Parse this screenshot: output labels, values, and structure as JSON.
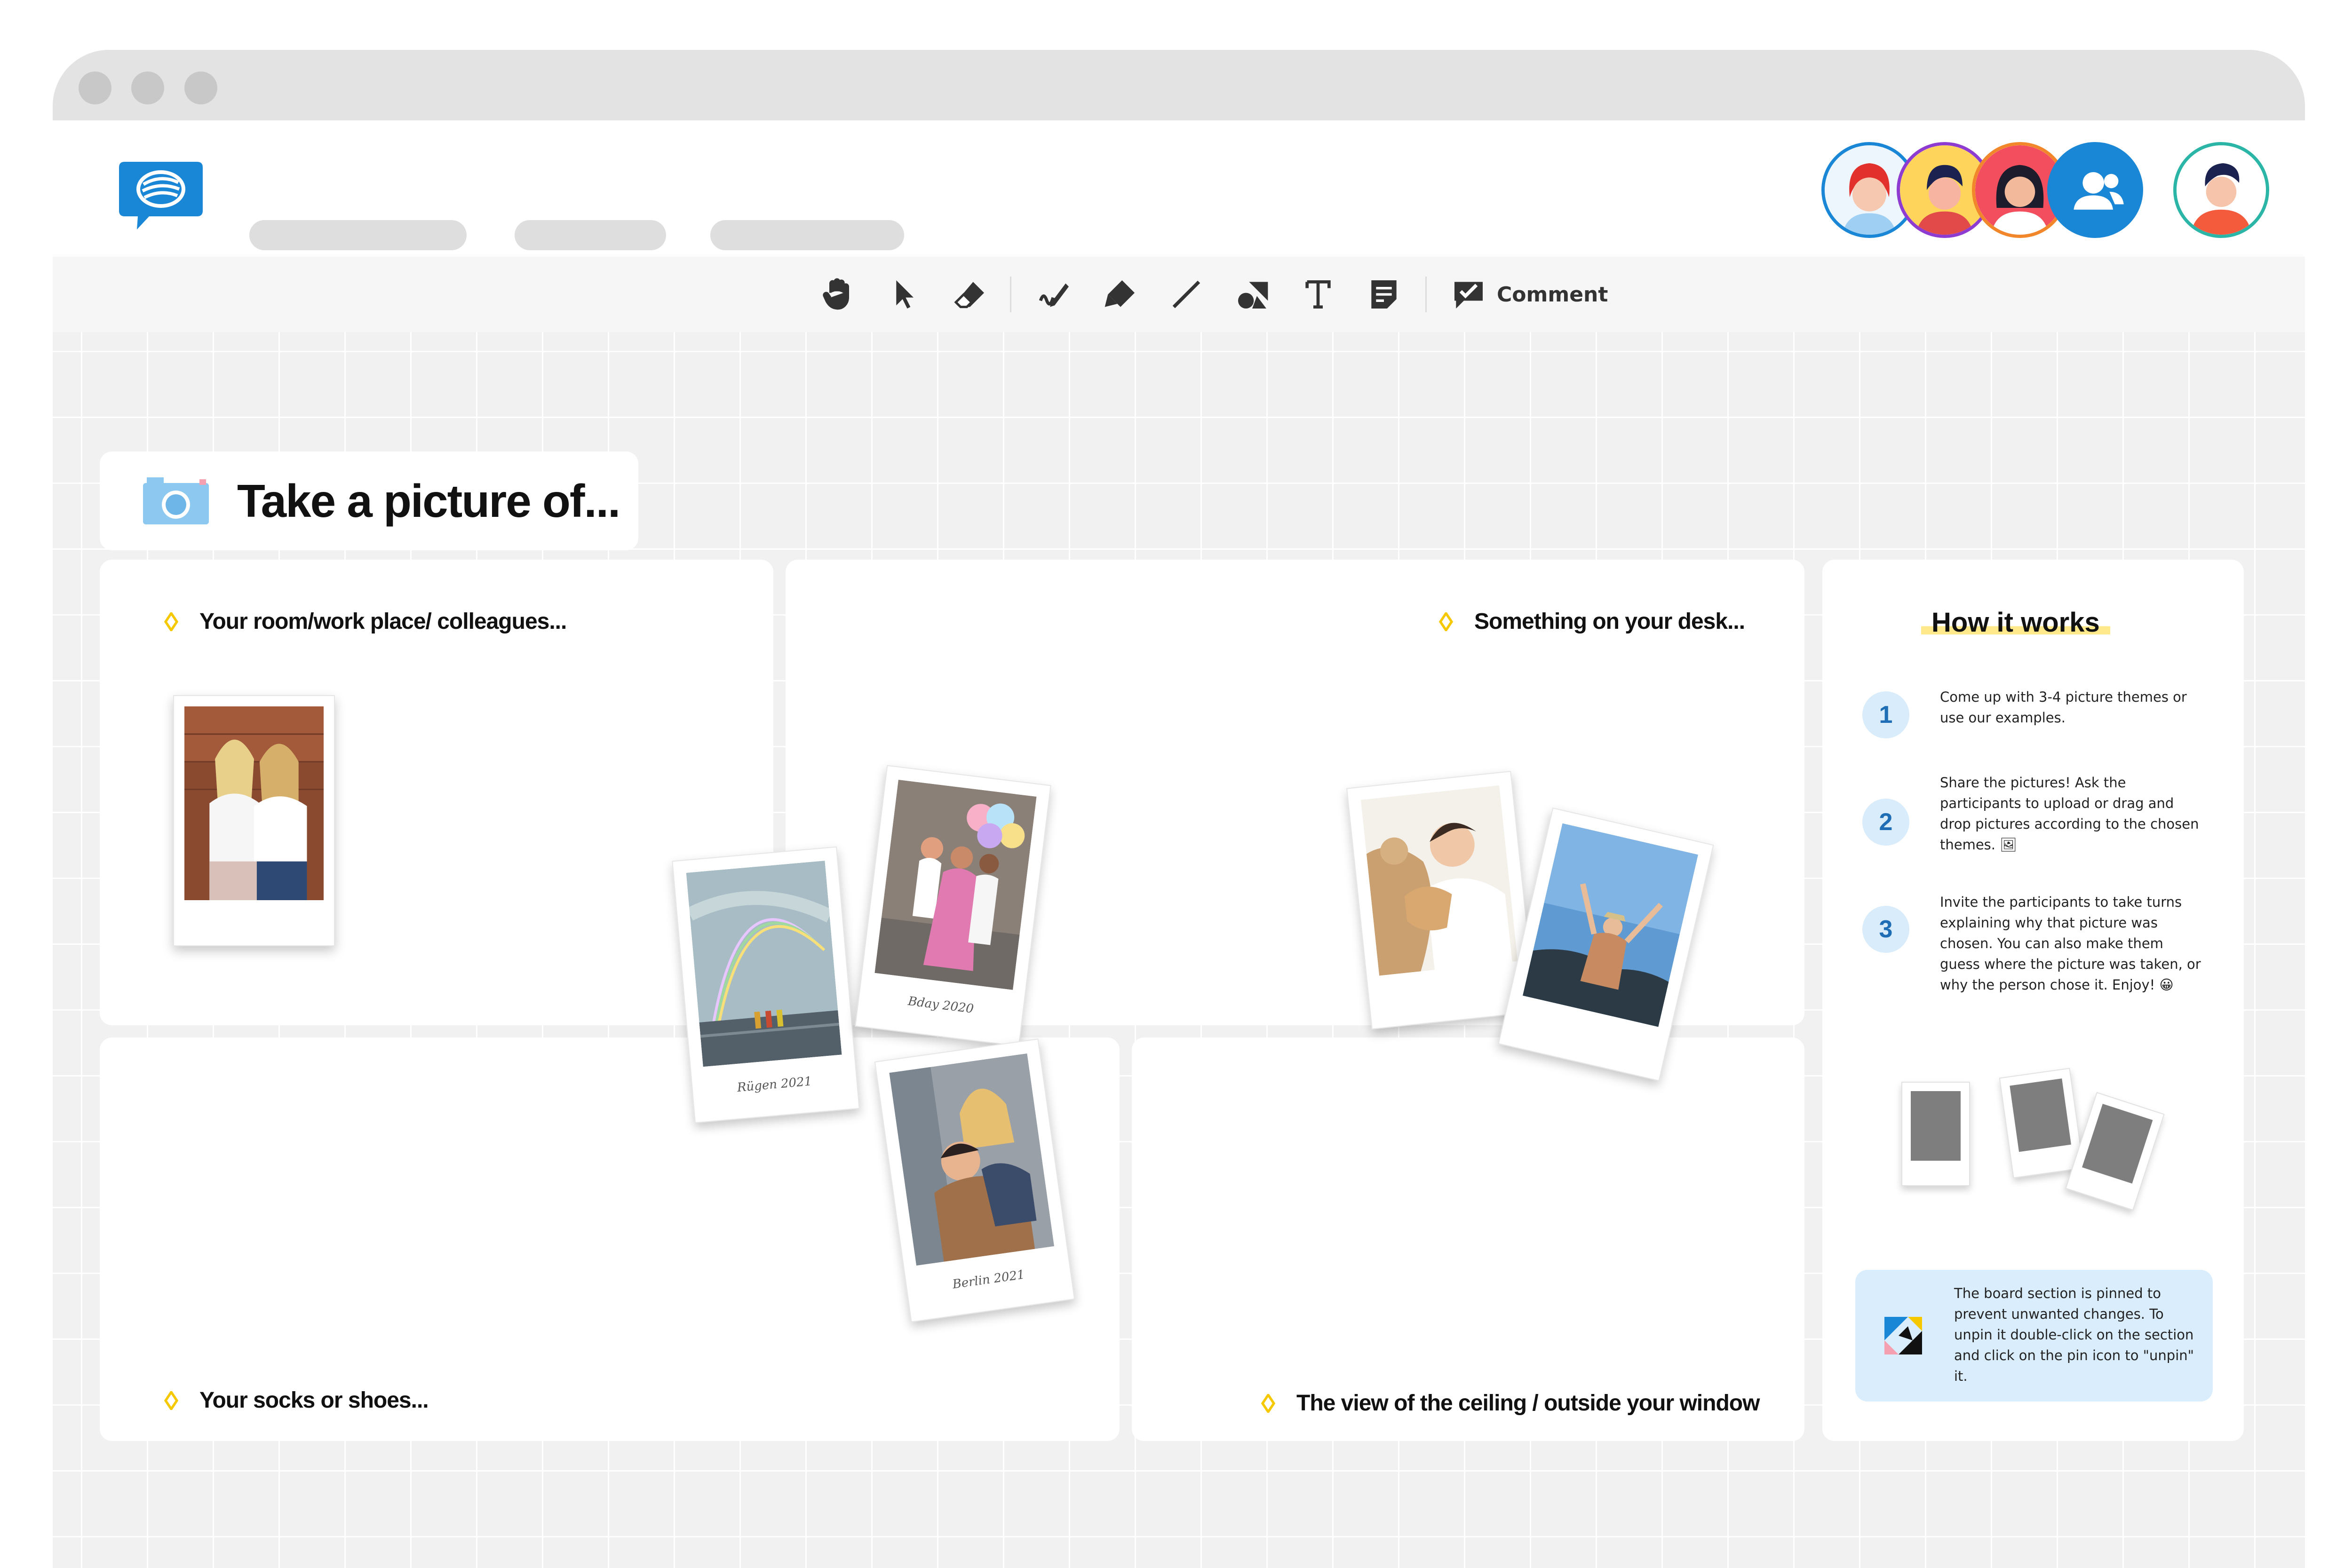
{
  "toolbar": {
    "tools": [
      "hand-tool",
      "select-tool",
      "eraser-tool",
      "pen-tool",
      "highlighter-tool",
      "line-tool",
      "shapes-tool",
      "text-tool",
      "sticky-note-tool"
    ],
    "comment_label": "Comment"
  },
  "board": {
    "title": "Take a picture of...",
    "sections": [
      {
        "label": "Your room/work place/ colleagues..."
      },
      {
        "label": "Something on your desk..."
      },
      {
        "label": "Your socks or shoes..."
      },
      {
        "label": "The view of the ceiling / outside your window"
      }
    ],
    "photos": [
      {
        "caption": "",
        "subject": "two women laughing"
      },
      {
        "caption": "Rügen 2021",
        "subject": "rainbow over sea"
      },
      {
        "caption": "Bday 2020",
        "subject": "friends with balloons"
      },
      {
        "caption": "Berlin 2021",
        "subject": "couple hugging"
      },
      {
        "caption": "",
        "subject": "boy hugging dog"
      },
      {
        "caption": "",
        "subject": "man on mountain top"
      }
    ]
  },
  "how_it_works": {
    "title": "How it works",
    "steps": [
      {
        "number": "1",
        "text": "Come up with 3-4 picture themes or use our examples."
      },
      {
        "number": "2",
        "text": "Share the pictures! Ask the participants to upload or drag and drop pictures according to the chosen themes. 🖼"
      },
      {
        "number": "3",
        "text": "Invite the participants to take turns explaining why that picture was chosen. You can also make them guess where the picture was taken, or why the person chose it. Enjoy! 😀"
      }
    ],
    "pinned_note": "The board section is pinned to prevent unwanted changes. To unpin it double-click on the section and click on the pin icon to \"unpin\" it."
  },
  "colors": {
    "brand_blue": "#1a86d6",
    "diamond_yellow": "#f5c800",
    "canvas_bg": "#f1f1f1",
    "note_bg": "#d9edfc"
  }
}
